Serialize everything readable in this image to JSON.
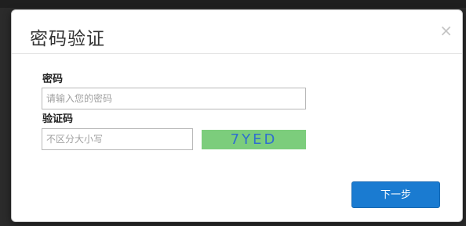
{
  "dialog": {
    "title": "密码验证",
    "close_icon": "close-icon",
    "close_glyph": "×"
  },
  "form": {
    "password": {
      "label": "密码",
      "placeholder": "请输入您的密码",
      "value": ""
    },
    "captcha": {
      "label": "验证码",
      "placeholder": "不区分大小写",
      "value": "",
      "image_text": "7YED"
    }
  },
  "actions": {
    "next_label": "下一步"
  },
  "colors": {
    "primary_button": "#1a7bd1",
    "captcha_bg": "#7ccd7c",
    "captcha_text": "#2f6ecf"
  }
}
